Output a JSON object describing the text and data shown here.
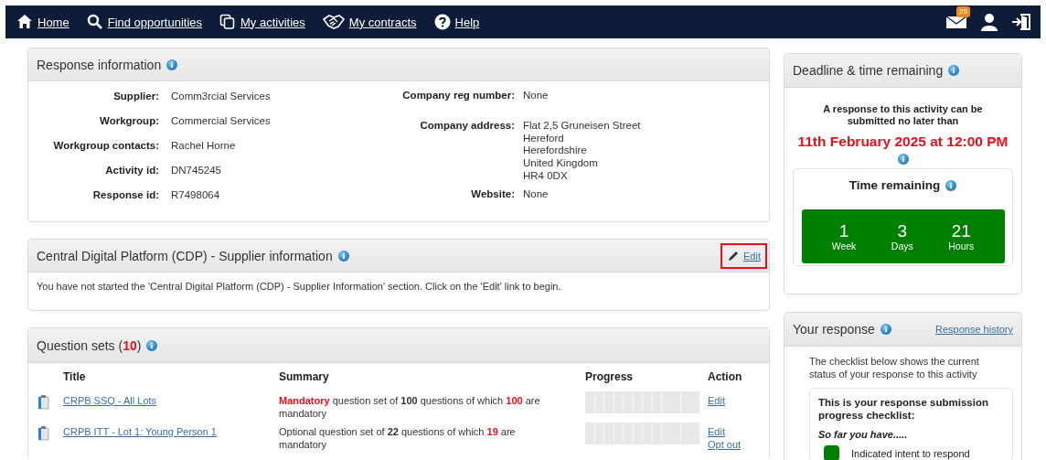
{
  "nav": {
    "items": [
      {
        "label": "Home",
        "kind": "home"
      },
      {
        "label": "Find opportunities",
        "kind": "search"
      },
      {
        "label": "My activities",
        "kind": "copy"
      },
      {
        "label": "My contracts",
        "kind": "handshake"
      },
      {
        "label": "Help",
        "kind": "help"
      }
    ],
    "messages_badge": "25"
  },
  "response_information": {
    "title": "Response information",
    "left_fields": [
      {
        "label": "Supplier:",
        "value": "Comm3rcial Services"
      },
      {
        "label": "Workgroup:",
        "value": "Commercial Services"
      },
      {
        "label": "Workgroup contacts:",
        "value": "Rachel Horne"
      },
      {
        "label": "Activity id:",
        "value": "DN745245"
      },
      {
        "label": "Response id:",
        "value": "R7498064"
      }
    ],
    "right_fields": [
      {
        "label": "Company reg number:",
        "lines": [
          "None"
        ]
      },
      {
        "label": "Company address:",
        "lines": [
          "Flat 2,5 Gruneisen Street",
          "Hereford",
          "Herefordshire",
          "United Kingdom",
          "HR4 0DX"
        ]
      },
      {
        "label": "Website:",
        "lines": [
          "None"
        ]
      }
    ]
  },
  "cdp": {
    "title": "Central Digital Platform (CDP) - Supplier information",
    "edit_link": {
      "label": "Edit",
      "highlighted": true
    },
    "message": "You have not started the 'Central Digital Platform (CDP) - Supplier Information' section. Click on the 'Edit' link to begin."
  },
  "question_sets": {
    "title": [
      {
        "text": "Question sets ("
      },
      {
        "text": "10",
        "kind": "alert"
      },
      {
        "text": ")"
      }
    ],
    "columns": [
      "Title",
      "Summary",
      "Progress",
      "Action"
    ],
    "rows": [
      {
        "title": "CRPB SSQ - All Lots",
        "summary": [
          {
            "text": "Mandatory",
            "kind": "alert"
          },
          {
            "text": " question set of "
          },
          {
            "text": "100",
            "kind": "bold"
          },
          {
            "text": " questions of which "
          },
          {
            "text": "100",
            "kind": "alert"
          },
          {
            "text": " are mandatory"
          }
        ],
        "progress": {
          "level": 0
        },
        "actions": [
          "Edit"
        ]
      },
      {
        "title": "CRPB ITT - Lot 1: Young Person 1",
        "summary": [
          {
            "text": "Optional question set of "
          },
          {
            "text": "22",
            "kind": "bold"
          },
          {
            "text": " questions of which "
          },
          {
            "text": "19",
            "kind": "alert"
          },
          {
            "text": " are mandatory"
          }
        ],
        "progress": {
          "level": 0
        },
        "actions": [
          "Edit",
          "Opt out"
        ]
      }
    ]
  },
  "deadline": {
    "title": "Deadline & time remaining",
    "intro": "A response to this activity can be submitted no later than",
    "date": "11th February 2025 at 12:00 PM",
    "time_title": "Time remaining",
    "units": [
      {
        "value": "1",
        "unit": "Week"
      },
      {
        "value": "3",
        "unit": "Days"
      },
      {
        "value": "21",
        "unit": "Hours"
      }
    ]
  },
  "your_response": {
    "title": "Your response",
    "history_link": "Response history",
    "intro": "The checklist below shows the current status of your response to this activity",
    "checklist_title": "This is your response submission progress checklist:",
    "so_far": "So far you have.....",
    "items": [
      {
        "label": "Indicated intent to respond",
        "completed": true
      }
    ]
  }
}
